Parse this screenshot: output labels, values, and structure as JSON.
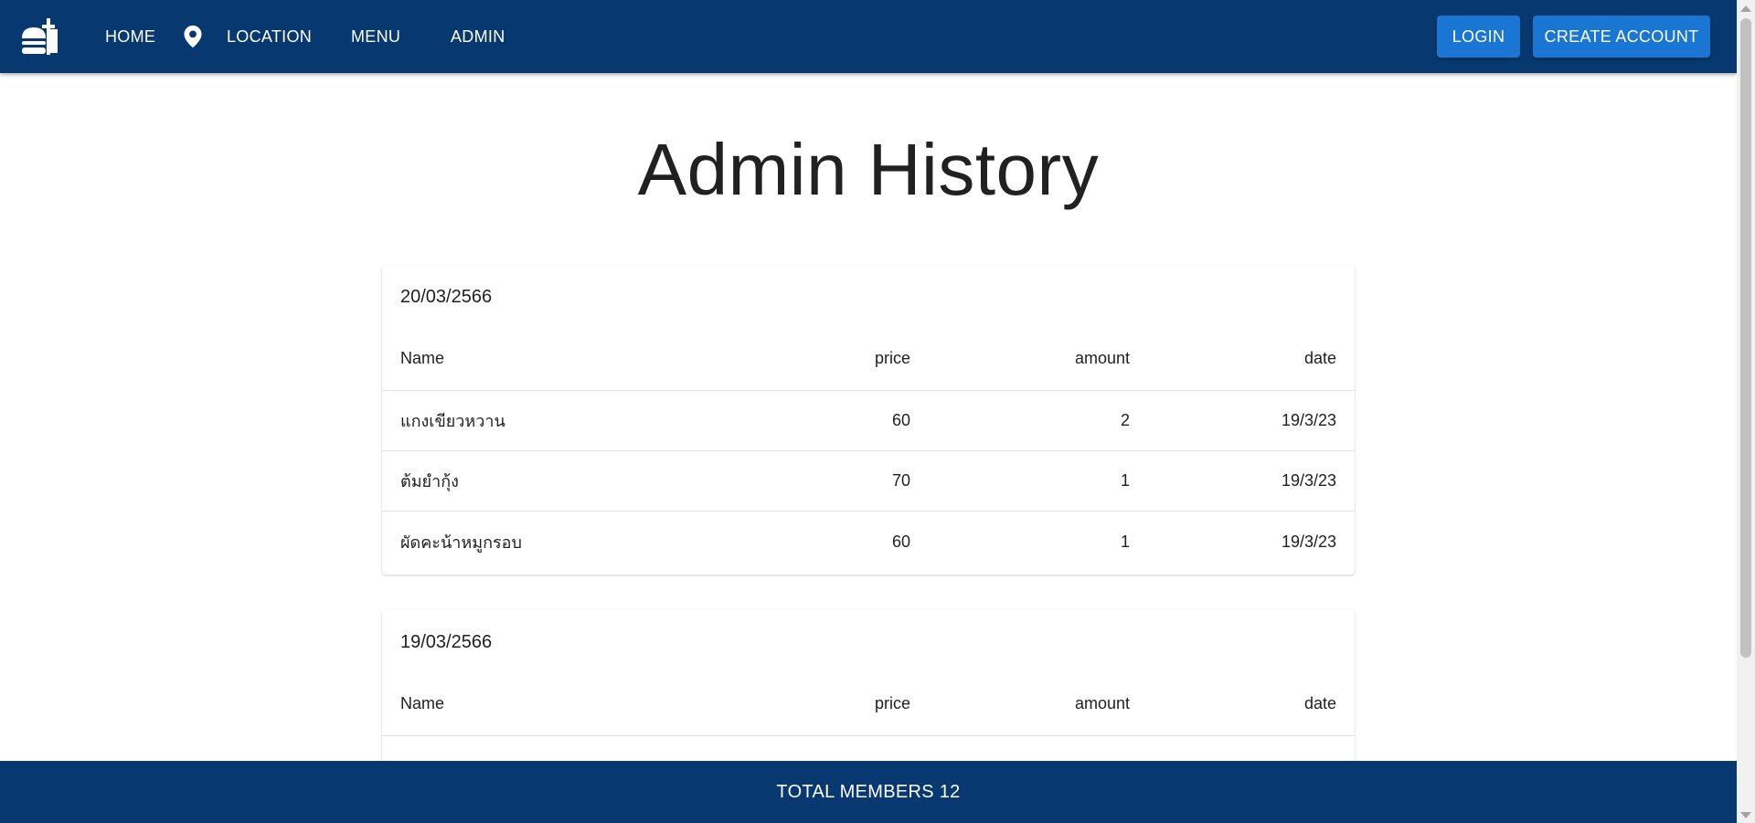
{
  "nav": {
    "logo_icon": "fastfood-icon",
    "home_label": "HOME",
    "location_icon": "map-pin-icon",
    "location_label": "LOCATION",
    "menu_label": "MENU",
    "admin_label": "ADMIN",
    "login_label": "LOGIN",
    "create_account_label": "CREATE ACCOUNT"
  },
  "page": {
    "title": "Admin History"
  },
  "columns": {
    "name": "Name",
    "price": "price",
    "amount": "amount",
    "date": "date"
  },
  "history": [
    {
      "heading": "20/03/2566",
      "rows": [
        {
          "name": "แกงเขียวหวาน",
          "price": "60",
          "amount": "2",
          "date": "19/3/23"
        },
        {
          "name": "ต้มยำกุ้ง",
          "price": "70",
          "amount": "1",
          "date": "19/3/23"
        },
        {
          "name": "ผัดคะน้าหมูกรอบ",
          "price": "60",
          "amount": "1",
          "date": "19/3/23"
        }
      ]
    },
    {
      "heading": "19/03/2566",
      "rows": []
    }
  ],
  "footer": {
    "text": "TOTAL MEMBERS 12"
  },
  "colors": {
    "primary_dark": "#07386f",
    "button_blue": "#1976d2"
  }
}
